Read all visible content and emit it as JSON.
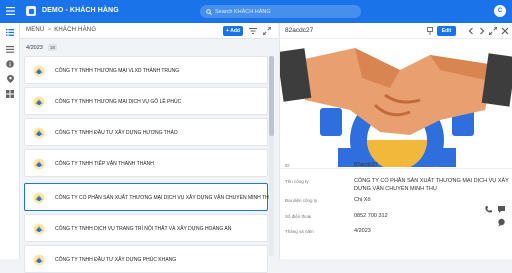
{
  "app": {
    "title": "DEMO - KHÁCH HÀNG",
    "search_placeholder": "Search KHÁCH HÀNG",
    "user_initial": "C",
    "accent_color": "#1a73e8"
  },
  "list": {
    "breadcrumb_menu": "MENU",
    "breadcrumb_separator": ">",
    "breadcrumb_current": "KHÁCH HÀNG",
    "add_label": "+ Add",
    "group_label": "4/2023",
    "group_count": "18",
    "items": [
      {
        "name": "CÔNG TY TNHH THƯƠNG MẠI VLXD THÀNH TRUNG"
      },
      {
        "name": "CÔNG TY TNHH THƯƠNG MẠI DỊCH VỤ GỖ LÊ PHÚC"
      },
      {
        "name": "CÔNG TY TNHH ĐẦU TƯ XÂY DỰNG HƯƠNG THẢO"
      },
      {
        "name": "CÔNG TY TNHH TIẾP VẬN THANH THÀNH"
      },
      {
        "name": "CÔNG TY CỔ PHẦN SẢN XUẤT THƯƠNG MẠI DỊCH VỤ XÂY DỰNG VẬN CHUYỂN MINH THU"
      },
      {
        "name": "CÔNG TY TNHH DỊCH VỤ TRANG TRÍ NỘI THẤT VÀ XÂY DỰNG HOÀNG AN"
      },
      {
        "name": "CÔNG TY TNHH ĐẦU TƯ XÂY DỰNG PHÚC KHANG"
      }
    ]
  },
  "detail": {
    "title": "82acdc27",
    "edit_label": "Edit",
    "fields": [
      {
        "label": "ID",
        "value": "82acdc27"
      },
      {
        "label": "Tên công ty",
        "value_line1": "CÔNG TY CỔ PHẦN SẢN XUẤT THƯƠNG MẠI DỊCH VỤ XÂY",
        "value_line2": "DỰNG VẬN CHUYỂN MINH THU"
      },
      {
        "label": "Đại diện công ty",
        "value": "Chị Xô"
      },
      {
        "label": "Số điện thoại",
        "value": "0852 700 312"
      },
      {
        "label": "Tháng và năm",
        "value": "4/2023"
      }
    ]
  }
}
